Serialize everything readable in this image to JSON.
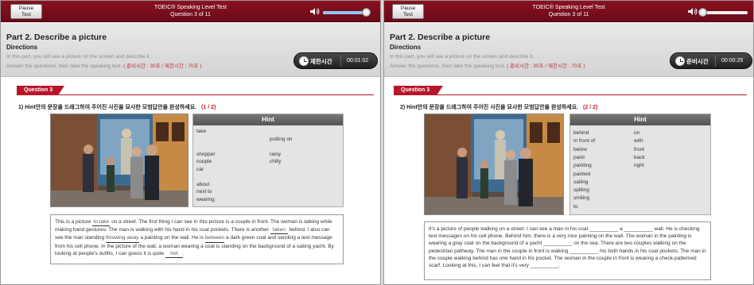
{
  "colors": {
    "accent_red": "#b7162a",
    "header_maroon": "#7a0d1c",
    "timer_dark": "#2a2a2a",
    "volume_fill": "#8fc4ff"
  },
  "screens": [
    {
      "pause_label_1": "Pause",
      "pause_label_2": "Test",
      "test_title": "TOEIC® Speaking Level Test",
      "question_counter": "Question 3 of 11",
      "volume_level": 0.9,
      "part_title": "Part 2. Describe a picture",
      "directions_label": "Directions",
      "dir_line1": "In this part, you will see a picture on the screen and describe it.",
      "dir_line2": "Answer the questions, then take the speaking test.",
      "dir_note": "( 준비시간 : 30초 / 제한시간 : 70초 )",
      "timer_label": "제한시간",
      "timer_value": "00:01:02",
      "question_tab": "Question 3",
      "question_text": "1) Hint안의 문장을 드래그하여 주어진 사진을 묘사한 모범답안을 완성하세요.",
      "question_count": "(1 / 2)",
      "hint_title": "Hint",
      "hint_col1": [
        "take",
        "",
        "",
        "shopper",
        "couple",
        "car",
        "",
        "about",
        "next to",
        "wearing"
      ],
      "hint_col2": [
        "",
        "putting on",
        "",
        "rainy",
        "chilly"
      ],
      "passage": [
        {
          "t": "This is a picture "
        },
        {
          "b": "to take"
        },
        {
          "t": " on a street. The first thing I can see in this picture is a couple in front. The woman is talking while making hand gestures. The man is walking with his hand in his coat pockets. There is another "
        },
        {
          "b": "taken"
        },
        {
          "t": " behind. I also can see the man standing "
        },
        {
          "b": "throwing away"
        },
        {
          "t": " a painting on the wall. He is "
        },
        {
          "b": "between"
        },
        {
          "t": " a dark green coat and sending a text message from his cell phone. In the picture of the wall, a woman wearing a coat is standing on the background of a sailing yacht. By looking at people's outfits, I can guess it is quite "
        },
        {
          "b": "hot"
        },
        {
          "t": "."
        }
      ]
    },
    {
      "pause_label_1": "Pause",
      "pause_label_2": "Test",
      "test_title": "TOEIC® Speaking Level Test",
      "question_counter": "Question 3 of 11",
      "volume_level": 0.05,
      "part_title": "Part 2. Describe a picture",
      "directions_label": "Directions",
      "dir_line1": "In this part, you will see a picture on the screen and describe it.",
      "dir_line2": "Answer the questions, then take the speaking test.",
      "dir_note": "( 준비시간 : 30초 / 제한시간 : 70초 )",
      "timer_label": "준비시간",
      "timer_value": "00:00:25",
      "question_tab": "Question 3",
      "question_text": "2) Hint안의 문장을 드래그하여 주어진 사진을 묘사한 모범답안을 완성하세요.",
      "question_count": "(2 / 2)",
      "hint_title": "Hint",
      "hint_col1": [
        "behind",
        "in front of",
        "below",
        "paint",
        "painting",
        "painted",
        "sailing",
        "spilling",
        "smiling",
        "to"
      ],
      "hint_col2": [
        "on",
        "with",
        "front",
        "back",
        "right"
      ],
      "passage": [
        {
          "t": "It's a picture of people walking on a street. I can see a man in his coat "
        },
        {
          "e": "__________"
        },
        {
          "t": " a "
        },
        {
          "e": "__________"
        },
        {
          "t": " wall. He is checking text messages on his cell phone. Behind him, there is a very nice painting on the wall. The woman in the painting is wearing a gray coat on the background of a yacht "
        },
        {
          "e": "__________"
        },
        {
          "t": " on the sea. There are two couples walking on the pedestrian pathway. The man in the couple in front is walking "
        },
        {
          "e": "__________"
        },
        {
          "t": " his both hands in his coat pockets. The man in the couple walking behind has one hand in his pocket. The woman in the couple in front is wearing a check-patterned scarf. Looking at this, I can feel that it's very "
        },
        {
          "e": "__________"
        },
        {
          "t": "."
        }
      ]
    }
  ]
}
